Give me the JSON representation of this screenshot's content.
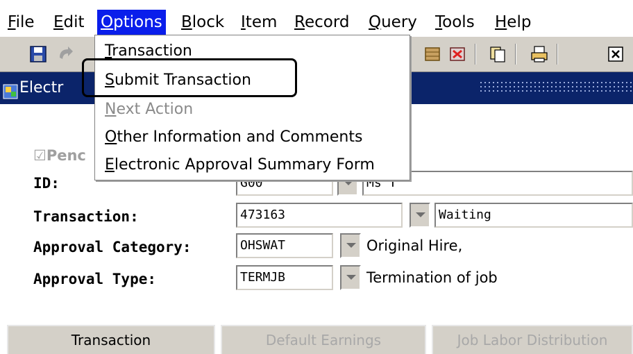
{
  "menubar": {
    "items": [
      {
        "label": "File"
      },
      {
        "label": "Edit"
      },
      {
        "label": "Options"
      },
      {
        "label": "Block"
      },
      {
        "label": "Item"
      },
      {
        "label": "Record"
      },
      {
        "label": "Query"
      },
      {
        "label": "Tools"
      },
      {
        "label": "Help"
      }
    ]
  },
  "window": {
    "title": "Electr"
  },
  "options_menu": {
    "items": [
      {
        "label": "Transaction",
        "enabled": true
      },
      {
        "label": "Submit Transaction",
        "enabled": true
      },
      {
        "label": "Next Action",
        "enabled": false
      },
      {
        "label": "Other Information and Comments",
        "enabled": true
      },
      {
        "label": "Electronic Approval Summary Form",
        "enabled": true
      }
    ]
  },
  "form": {
    "pending_label": "☑Penc",
    "id_label": "ID:",
    "id_value": "G00",
    "id_name": "Ms T",
    "transaction_label": "Transaction:",
    "transaction_value": "473163",
    "transaction_status": "Waiting",
    "approval_category_label": "Approval Category:",
    "approval_category_value": "OHSWAT",
    "approval_category_desc": "Original Hire,",
    "approval_type_label": "Approval Type:",
    "approval_type_value": "TERMJB",
    "approval_type_desc": "Termination of job"
  },
  "tabs": [
    {
      "label": "Transaction",
      "enabled": true
    },
    {
      "label": "Default Earnings",
      "enabled": false
    },
    {
      "label": "Job Labor Distribution",
      "enabled": false
    }
  ],
  "colors": {
    "menu_highlight": "#0a1eeb",
    "titlebar": "#0b246a",
    "chrome": "#d4d0c8"
  }
}
